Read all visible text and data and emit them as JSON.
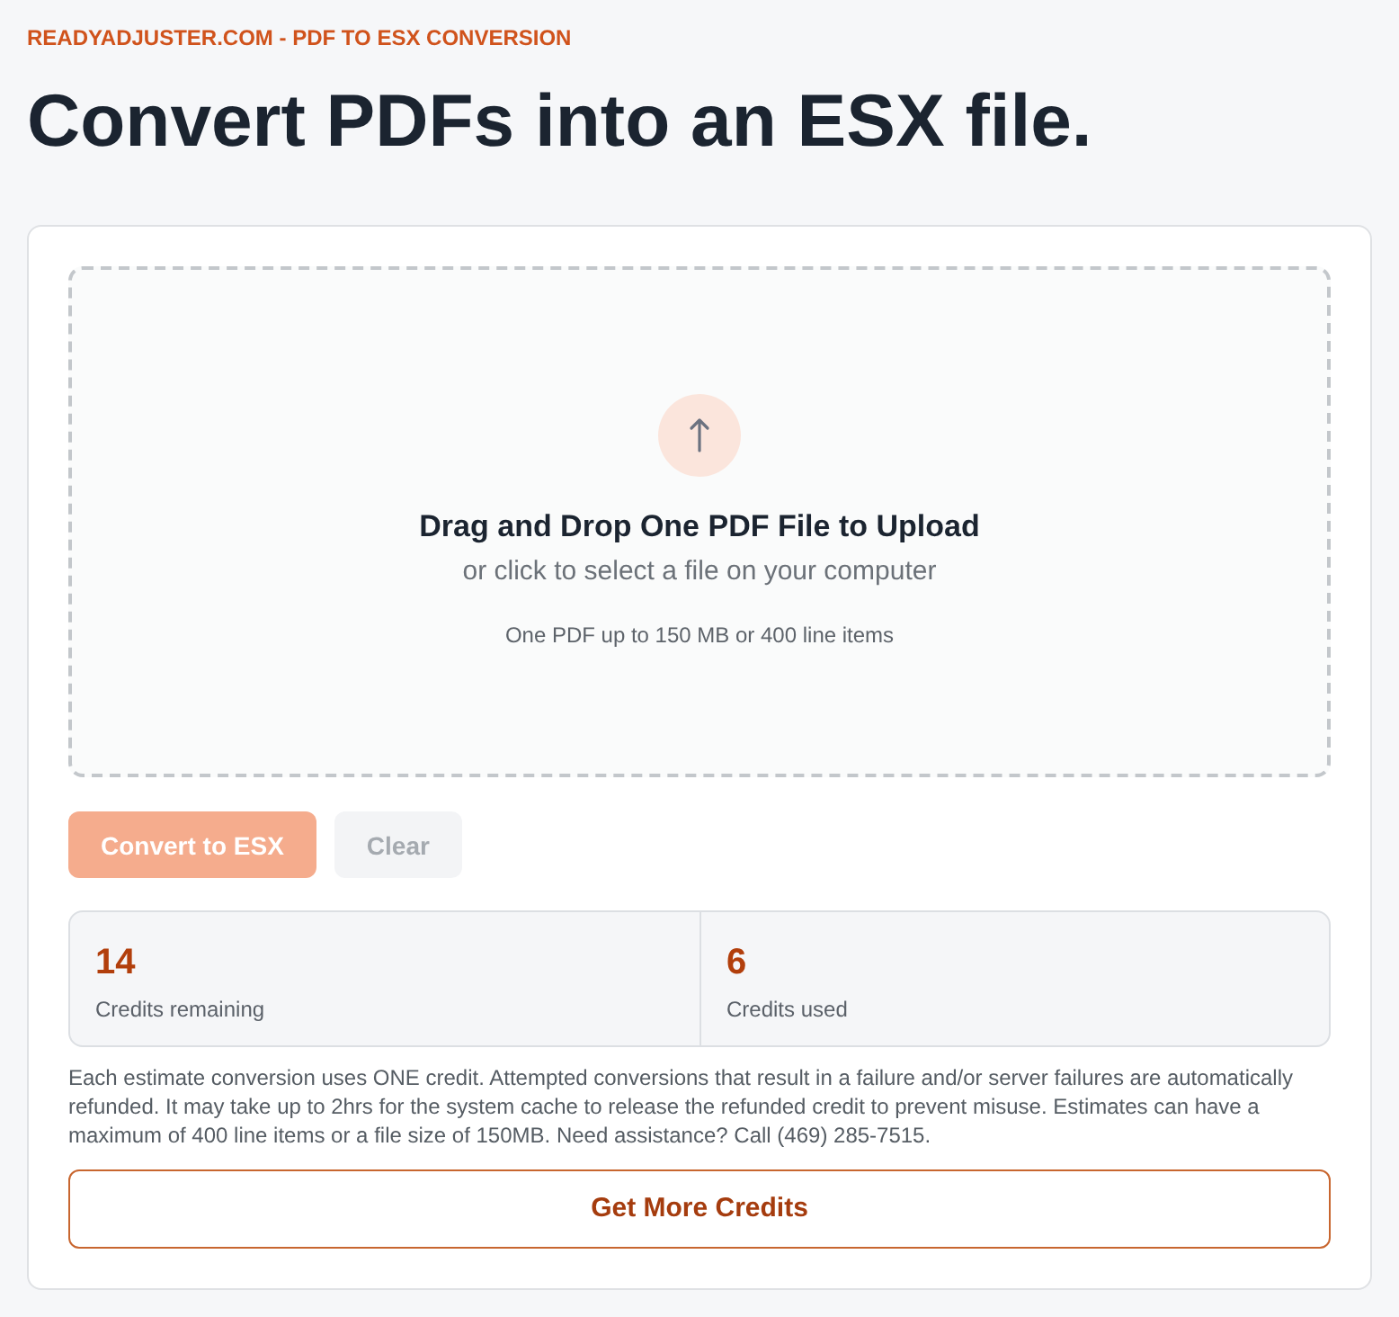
{
  "header": {
    "eyebrow": "READYADJUSTER.COM - PDF TO ESX CONVERSION",
    "title": "Convert PDFs into an ESX file."
  },
  "dropzone": {
    "title": "Drag and Drop One PDF File to Upload",
    "subtitle": "or click to select a file on your computer",
    "hint": "One PDF up to 150 MB or 400 line items"
  },
  "actions": [
    {
      "kind": "primary",
      "label": "Convert to ESX",
      "disabled": true
    },
    {
      "kind": "secondary",
      "label": "Clear",
      "disabled": true
    }
  ],
  "stats": [
    {
      "value": "14",
      "label": "Credits remaining"
    },
    {
      "value": "6",
      "label": "Credits used"
    }
  ],
  "notice": "Each estimate conversion uses ONE credit. Attempted conversions that result in a failure and/or server failures are automatically refunded. It may take up to 2hrs for the system cache to release the refunded credit to prevent misuse. Estimates can have a maximum of 400 line items or a file size of 150MB. Need assistance? Call (469) 285-7515.",
  "cta": {
    "label": "Get More Credits"
  }
}
